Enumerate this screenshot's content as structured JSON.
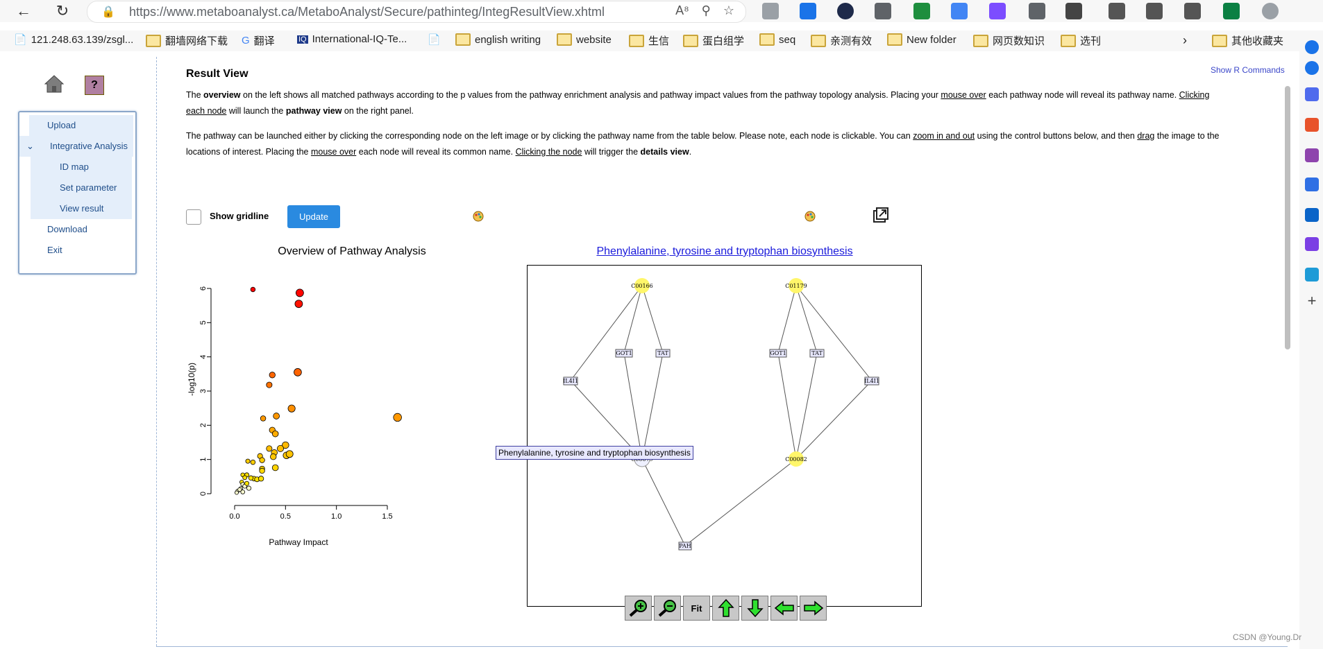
{
  "browser": {
    "url": "https://www.metaboanalyst.ca/MetaboAnalyst/Secure/pathinteg/IntegResultView.xhtml",
    "bookmarks": [
      "121.248.63.139/zsgl...",
      "翻墙网络下载",
      "翻译",
      "International-IQ-Te...",
      "english writing",
      "website",
      "生信",
      "蛋白组学",
      "seq",
      "亲测有效",
      "New folder",
      "网页数知识",
      "选刊"
    ],
    "other_bookmarks": "其他收藏夹"
  },
  "sidebar": {
    "help_glyph": "?",
    "menu": [
      {
        "label": "Upload"
      },
      {
        "label": "Integrative Analysis"
      },
      {
        "label": "ID map"
      },
      {
        "label": "Set parameter"
      },
      {
        "label": "View result"
      },
      {
        "label": "Download"
      },
      {
        "label": "Exit"
      }
    ]
  },
  "main": {
    "title": "Result View",
    "show_r_commands": "Show R Commands",
    "para1": {
      "t1": "The ",
      "b1": "overview",
      "t2": " on the left shows all matched pathways according to the p values from the pathway enrichment analysis and pathway impact values from the pathway topology analysis. Placing your ",
      "u1": "mouse over",
      "t3": " each pathway node will reveal its pathway name. ",
      "u2": "Clicking each node",
      "t4": " will launch the ",
      "b2": "pathway view",
      "t5": " on the right panel."
    },
    "para2": {
      "t1": "The pathway can be launched either by clicking the corresponding node on the left image or by clicking the pathway name from the table below. Please note, each node is clickable. You can ",
      "u1": "zoom in and out",
      "t2": " using the control buttons below, and then ",
      "u2": "drag",
      "t3": " the image to the locations of interest. Placing the ",
      "u3": "mouse over",
      "t4": " each node will reveal its common name. ",
      "u4": "Clicking the node",
      "t5": " will trigger the ",
      "b1": "details view",
      "t6": "."
    },
    "show_gridline": "Show gridline",
    "update_button": "Update",
    "overview_title": "Overview of Pathway Analysis",
    "pathway_title": "Phenylalanine, tyrosine and tryptophan biosynthesis",
    "tooltip": "Phenylalanine, tyrosine and tryptophan biosynthesis",
    "controls": {
      "fit": "Fit"
    }
  },
  "network": {
    "nodes": [
      "C00166",
      "C01179",
      "GOT1",
      "TAT",
      "GOT1",
      "TAT",
      "IL4I1",
      "IL4I1",
      "C00079",
      "C00082",
      "PAH"
    ]
  },
  "watermark": "CSDN @Young.Dr",
  "chart_data": {
    "type": "scatter",
    "title": "Overview of Pathway Analysis",
    "xlabel": "Pathway Impact",
    "ylabel": "-log10(p)",
    "xlim": [
      0,
      1.6
    ],
    "ylim": [
      0,
      6.2
    ],
    "xticks": [
      "0.0",
      "0.5",
      "1.0",
      "1.5"
    ],
    "yticks": [
      "0",
      "1",
      "2",
      "3",
      "4",
      "5",
      "6"
    ],
    "points": [
      {
        "x": 0.18,
        "y": 5.97
      },
      {
        "x": 0.64,
        "y": 5.87
      },
      {
        "x": 0.63,
        "y": 5.55
      },
      {
        "x": 0.37,
        "y": 3.47
      },
      {
        "x": 0.62,
        "y": 3.55
      },
      {
        "x": 0.34,
        "y": 3.18
      },
      {
        "x": 0.28,
        "y": 2.2
      },
      {
        "x": 0.41,
        "y": 2.27
      },
      {
        "x": 0.56,
        "y": 2.49
      },
      {
        "x": 1.6,
        "y": 2.23
      },
      {
        "x": 0.37,
        "y": 1.86
      },
      {
        "x": 0.4,
        "y": 1.75
      },
      {
        "x": 0.5,
        "y": 1.42
      },
      {
        "x": 0.45,
        "y": 1.32
      },
      {
        "x": 0.34,
        "y": 1.32
      },
      {
        "x": 0.39,
        "y": 1.2
      },
      {
        "x": 0.38,
        "y": 1.08
      },
      {
        "x": 0.51,
        "y": 1.12
      },
      {
        "x": 0.54,
        "y": 1.16
      },
      {
        "x": 0.25,
        "y": 1.1
      },
      {
        "x": 0.27,
        "y": 0.98
      },
      {
        "x": 0.18,
        "y": 0.92
      },
      {
        "x": 0.13,
        "y": 0.95
      },
      {
        "x": 0.27,
        "y": 0.73
      },
      {
        "x": 0.27,
        "y": 0.67
      },
      {
        "x": 0.4,
        "y": 0.76
      },
      {
        "x": 0.19,
        "y": 0.44
      },
      {
        "x": 0.22,
        "y": 0.42
      },
      {
        "x": 0.26,
        "y": 0.44
      },
      {
        "x": 0.08,
        "y": 0.55
      },
      {
        "x": 0.12,
        "y": 0.55
      },
      {
        "x": 0.1,
        "y": 0.47
      },
      {
        "x": 0.16,
        "y": 0.46
      },
      {
        "x": 0.07,
        "y": 0.34
      },
      {
        "x": 0.08,
        "y": 0.27
      },
      {
        "x": 0.1,
        "y": 0.22
      },
      {
        "x": 0.12,
        "y": 0.3
      },
      {
        "x": 0.06,
        "y": 0.15
      },
      {
        "x": 0.14,
        "y": 0.16
      },
      {
        "x": 0.03,
        "y": 0.08
      },
      {
        "x": 0.05,
        "y": 0.12
      },
      {
        "x": 0.08,
        "y": 0.05
      },
      {
        "x": 0.02,
        "y": 0.03
      }
    ]
  }
}
